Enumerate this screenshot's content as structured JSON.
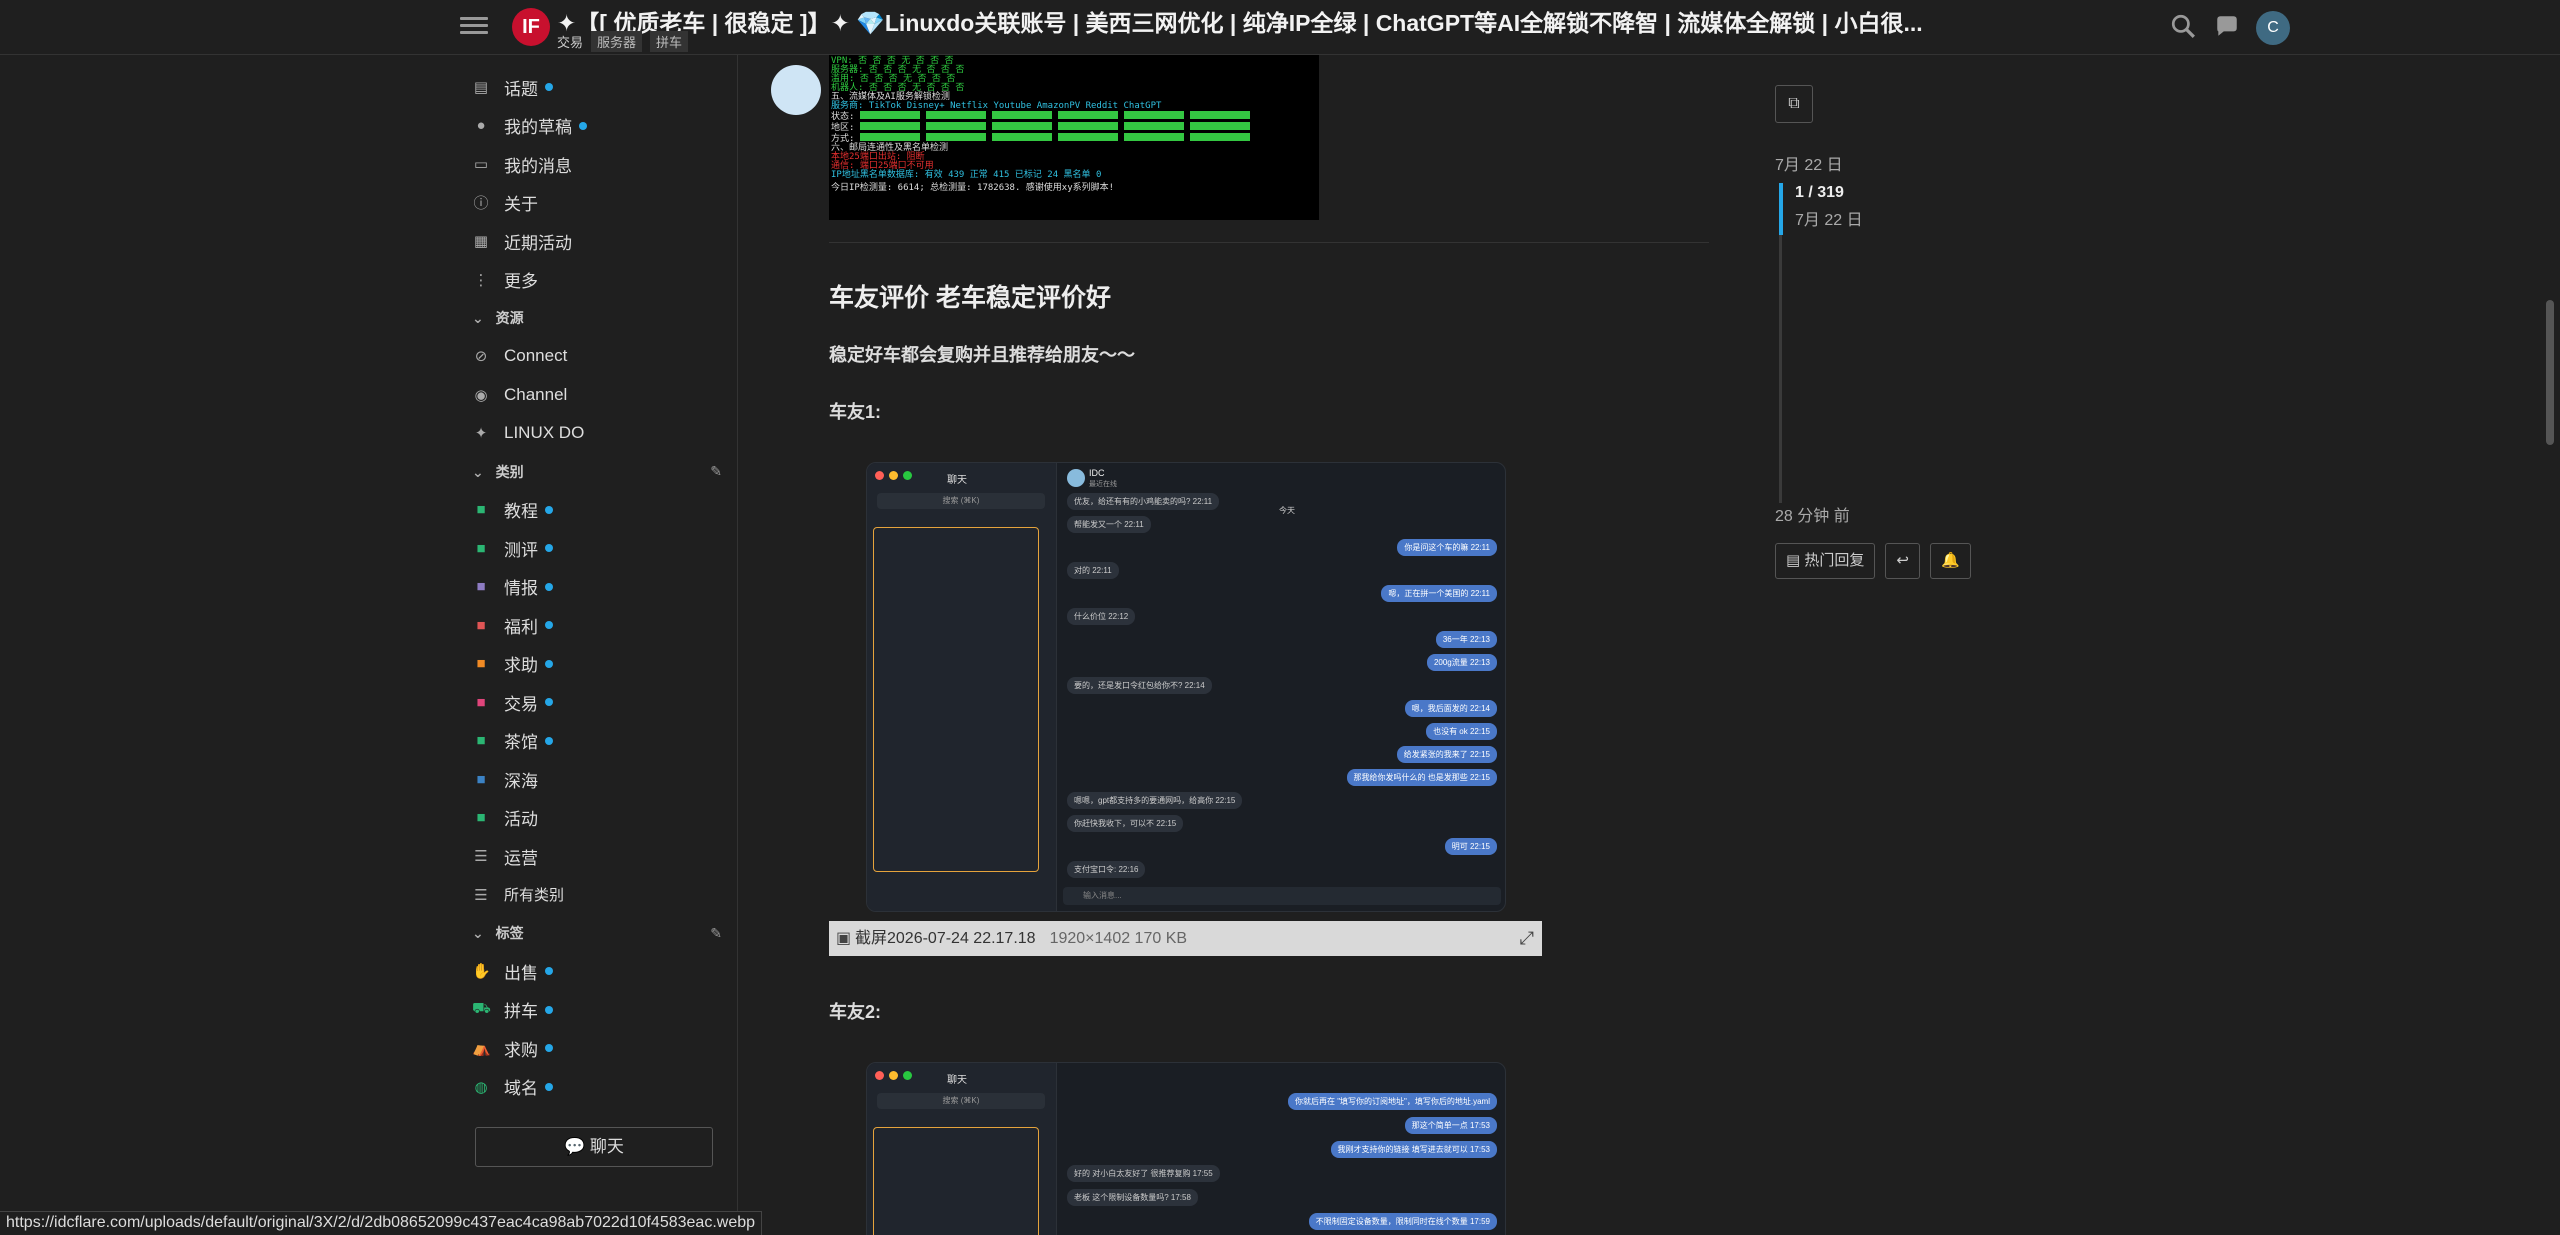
{
  "header": {
    "title": "✦【[ 优质老车 | 很稳定 ]】✦ 💎Linuxdo关联账号 | 美西三网优化 | 纯净IP全绿 | ChatGPT等AI全解锁不降智 | 流媒体全解锁 | 小白很...",
    "logo_text": "IF",
    "category": "交易",
    "tags": [
      "服务器",
      "拼车"
    ],
    "avatar_letter": "C"
  },
  "sidebar": {
    "items": [
      {
        "label": "话题",
        "icon": "layers-icon",
        "dot": true
      },
      {
        "label": "我的草稿",
        "icon": "user-icon",
        "dot": true
      },
      {
        "label": "我的消息",
        "icon": "inbox-icon",
        "dot": false
      },
      {
        "label": "关于",
        "icon": "info-icon",
        "dot": false
      },
      {
        "label": "近期活动",
        "icon": "calendar-icon",
        "dot": false
      },
      {
        "label": "更多",
        "icon": "more-icon",
        "dot": false
      }
    ],
    "resources_heading": "资源",
    "resources": [
      {
        "label": "Connect",
        "icon": "link-icon"
      },
      {
        "label": "Channel",
        "icon": "send-icon"
      },
      {
        "label": "LINUX DO",
        "icon": "sparkle-icon"
      }
    ],
    "categories_heading": "类别",
    "categories": [
      {
        "label": "教程",
        "color": "#2bb673"
      },
      {
        "label": "测评",
        "color": "#2bb673"
      },
      {
        "label": "情报",
        "color": "#8e7cc3"
      },
      {
        "label": "福利",
        "color": "#e05555"
      },
      {
        "label": "求助",
        "color": "#f08a24"
      },
      {
        "label": "交易",
        "color": "#e0457b"
      },
      {
        "label": "茶馆",
        "color": "#2bb673"
      },
      {
        "label": "深海",
        "color": "#3b82c4"
      },
      {
        "label": "活动",
        "color": "#2bb673"
      },
      {
        "label": "运营",
        "color": "#aaaaaa"
      },
      {
        "label": "所有类别",
        "color": "#aaaaaa"
      }
    ],
    "tags_heading": "标签",
    "tags": [
      {
        "label": "出售"
      },
      {
        "label": "拼车"
      },
      {
        "label": "求购"
      },
      {
        "label": "域名"
      }
    ],
    "chat_label": "💬 聊天"
  },
  "post": {
    "heading": "车友评价 老车稳定评价好",
    "subline": "稳定好车都会复购并且推荐给朋友～～",
    "review1_label": "车友1:",
    "review2_label": "车友2:",
    "terminal": {
      "line1": "VPN:    否    否    否    无    否    否    否",
      "line2": "服务器:  否    否    否    无    否    否    否",
      "line3": "滥用:   否    否    否    无    否    否    否",
      "line4": "机器人:  否    否    否    无    否    否    否",
      "line5": "五、流媒体及AI服务解锁检测",
      "services": "服务商:    TikTok  Disney+  Netflix  Youtube  AmazonPV  Reddit  ChatGPT",
      "row_status": "状态:",
      "row_region": "地区:",
      "row_method": "方式:",
      "line6": "六、邮局连通性及黑名单检测",
      "line7": "本地25端口出站: 阻断",
      "line8": "通信: 端口25端口不可用",
      "line9": "IP地址黑名单数据库:  有效 439  正常 415  已标记 24  黑名单 0",
      "line10": "今日IP检测量: 6614; 总检测量: 1782638. 感谢使用xy系列脚本!"
    },
    "chat1": {
      "title": "聊天",
      "search": "搜索 (⌘K)",
      "contact": "IDC",
      "subtitle": "最近在线",
      "today": "今天",
      "input": "输入消息...",
      "messages": [
        {
          "side": "l",
          "text": "优友，给还有有的小鸡能卖的吗? 22:11"
        },
        {
          "side": "l",
          "text": "帮能发又一个 22:11"
        },
        {
          "side": "r",
          "text": "你是问这个车的嘛 22:11"
        },
        {
          "side": "l",
          "text": "对的 22:11"
        },
        {
          "side": "r",
          "text": "嗯，正在拼一个美国的 22:11"
        },
        {
          "side": "l",
          "text": "什么价位 22:12"
        },
        {
          "side": "r",
          "text": "36一年 22:13"
        },
        {
          "side": "r",
          "text": "200g流量 22:13"
        },
        {
          "side": "l",
          "text": "要的，还是发口令红包给你不? 22:14"
        },
        {
          "side": "r",
          "text": "嗯，我后面发的 22:14"
        },
        {
          "side": "r",
          "text": "也没有 ok 22:15"
        },
        {
          "side": "r",
          "text": "给发紧张的我来了 22:15"
        },
        {
          "side": "r",
          "text": "那我给你发吗什么的 也是发那些 22:15"
        },
        {
          "side": "l",
          "text": "嗯嗯，gpt都支持多的要通网吗，给高你 22:15"
        },
        {
          "side": "l",
          "text": "你赶快我收下，可以不 22:15"
        },
        {
          "side": "r",
          "text": "明可 22:15"
        },
        {
          "side": "l",
          "text": "支付宝口令: 22:16"
        }
      ]
    },
    "caption": {
      "name": "截屏2026-07-24 22.17.18",
      "dims": "1920×1402 170 KB"
    },
    "chat2": {
      "title": "聊天",
      "search": "搜索 (⌘K)",
      "messages": [
        {
          "side": "r",
          "text": "你就后再在 \"填写你的订阅地址\"，填写你后的地址.yaml"
        },
        {
          "side": "r",
          "text": "那这个简单一点 17:53"
        },
        {
          "side": "r",
          "text": "我刚才支持你的链接 填写进去就可以 17:53"
        },
        {
          "side": "l",
          "text": "好的 对小白太友好了 很推荐复购 17:55"
        },
        {
          "side": "l",
          "text": "老板 这个限制设备数量吗? 17:58"
        },
        {
          "side": "r",
          "text": "不限制固定设备数量，限制同时在线个数量 17:59"
        }
      ]
    }
  },
  "timeline": {
    "date": "7月 22 日",
    "position": "1 / 319",
    "position_date": "7月 22 日",
    "ago": "28 分钟 前",
    "hot_reply": "热门回复",
    "progress": 0.003
  },
  "status_url": "https://idcflare.com/uploads/default/original/3X/2/d/2db08652099c437eac4ca98ab7022d10f4583eac.webp"
}
